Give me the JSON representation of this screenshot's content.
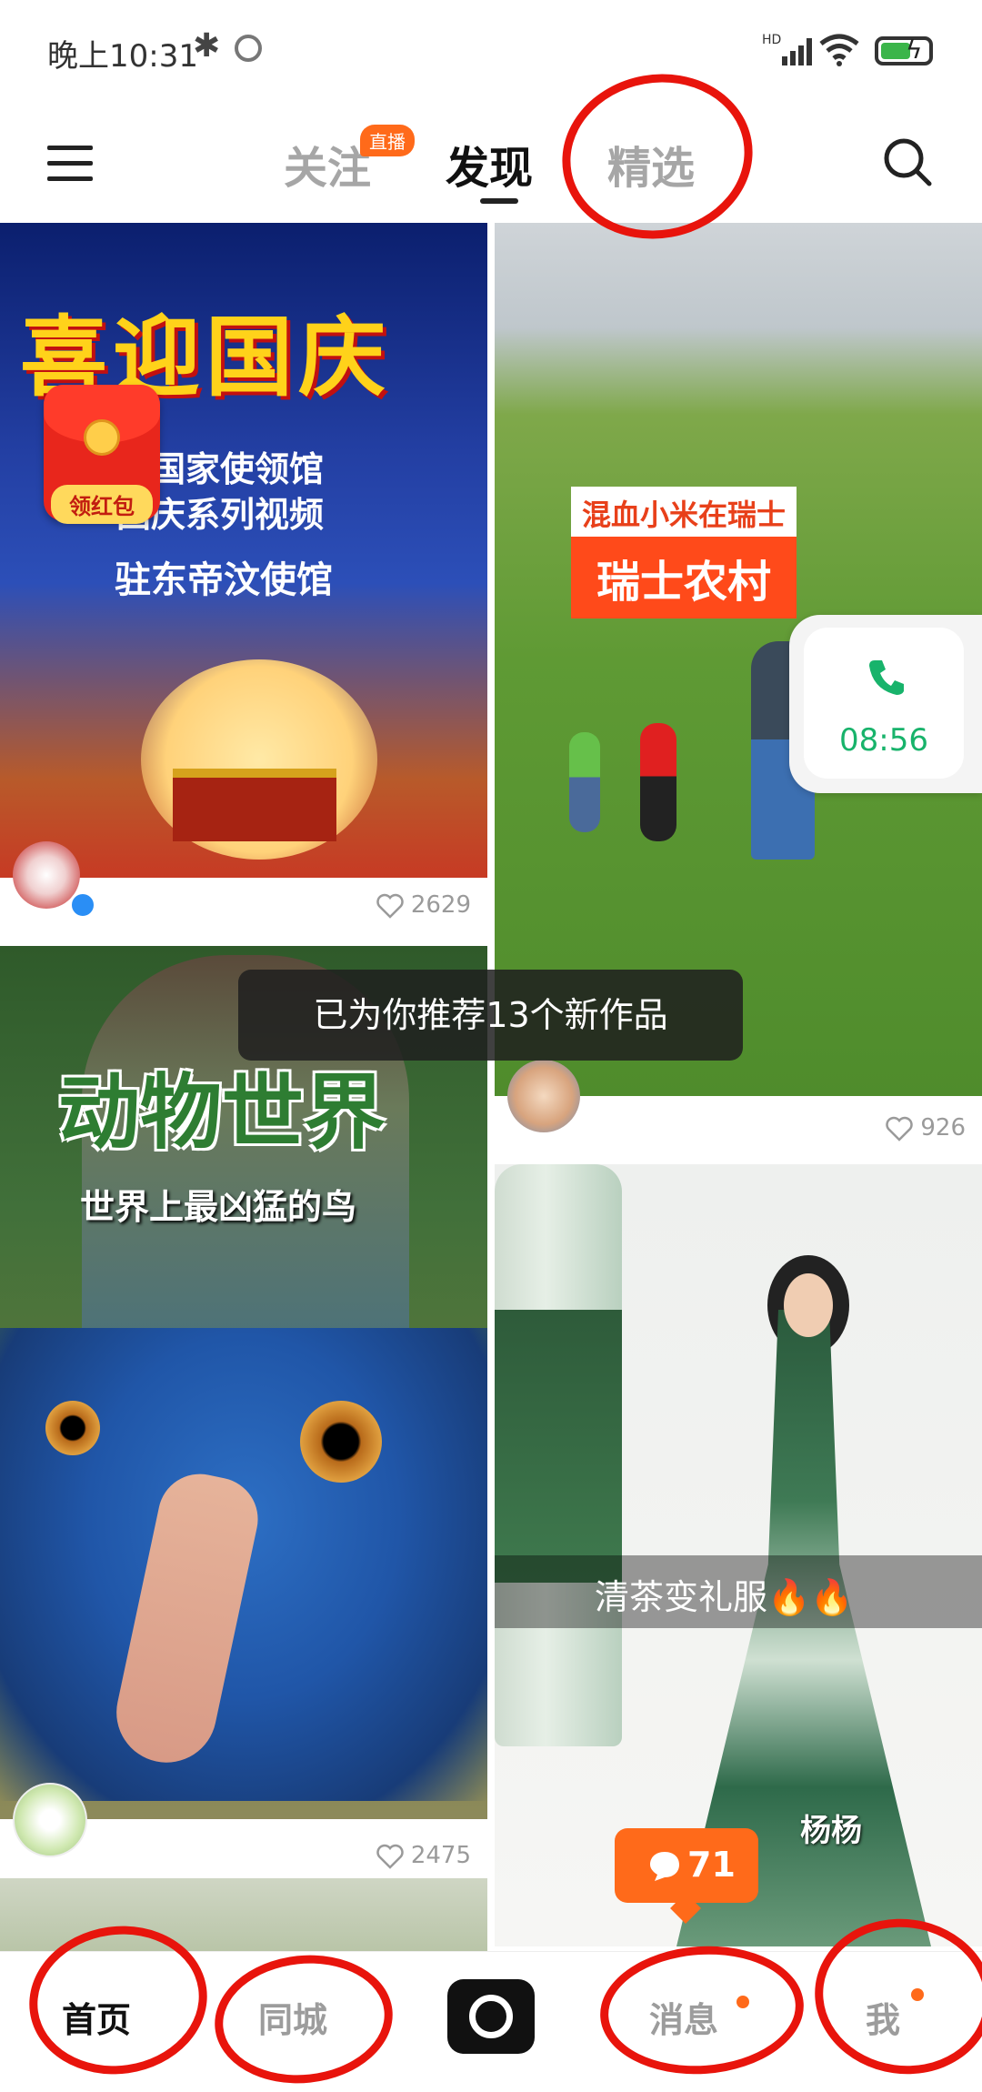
{
  "status_bar": {
    "time": "晚上10:31",
    "network": "HD"
  },
  "nav": {
    "tabs": [
      {
        "label": "关注",
        "badge": "直播"
      },
      {
        "label": "发现",
        "active": true
      },
      {
        "label": "精选"
      }
    ]
  },
  "feed": [
    {
      "title": "喜迎国庆",
      "sub1": "边国家使领馆",
      "sub2": "国庆系列视频",
      "sub3": "驻东帝汶使馆",
      "red_packet_label": "领红包",
      "likes": "2629"
    },
    {
      "tag_small": "混血小米在瑞士",
      "tag_big": "瑞士农村",
      "likes": "926"
    },
    {
      "title": "动物世界",
      "subtitle": "世界上最凶猛的鸟",
      "likes": "2475"
    },
    {
      "caption": "清茶变礼服🔥🔥",
      "author": "杨杨"
    }
  ],
  "call_bubble": {
    "time": "08:56"
  },
  "toast": "已为你推荐13个新作品",
  "message_badge": {
    "count": "71"
  },
  "bottom_nav": {
    "home": "首页",
    "local": "同城",
    "messages": "消息",
    "me": "我"
  },
  "colors": {
    "accent": "#ff6a1a",
    "annotation": "#e8140c",
    "call_green": "#18b36b"
  }
}
